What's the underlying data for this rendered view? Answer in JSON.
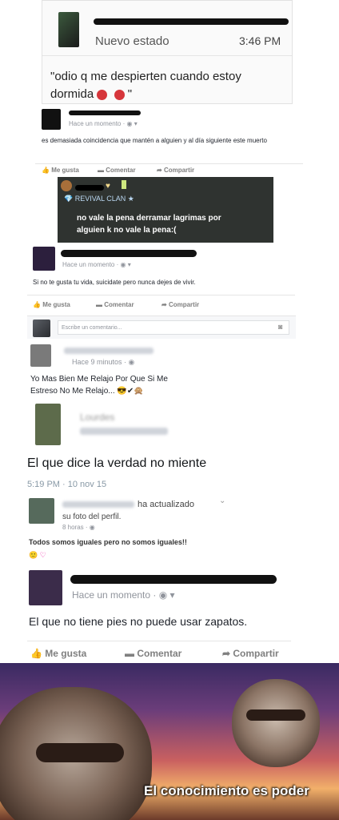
{
  "post1": {
    "status_label": "Nuevo estado",
    "time": "3:46 PM",
    "text_line1": "\"odio q me despierten cuando estoy",
    "text_line2_a": "dormida",
    "text_line2_b": "\""
  },
  "post2": {
    "time": "Hace un momento · ",
    "text": "es demasiada coincidencia que mantén a alguien y al día siguiente este muerto",
    "like": "Me gusta",
    "comment": "Comentar",
    "share": "Compartir"
  },
  "post3": {
    "clan": "REVIVAL CLAN ★",
    "text_line1": "no vale la pena derramar lagrimas por",
    "text_line2": "alguien k no vale la pena:("
  },
  "post4": {
    "time": "Hace un momento · ",
    "text": "Si no te gusta tu vida, suicidate pero nunca dejes de vivir.",
    "like": "Me gusta",
    "comment": "Comentar",
    "share": "Compartir",
    "comment_placeholder": "Escribe un comentario..."
  },
  "post5": {
    "time": "Hace 9 minutos · ",
    "text_line1": "Yo Mas Bien Me Relajo Por Que Si Me",
    "text_line2": "Estreso No Me Relajo..."
  },
  "post6": {
    "name": "Lourdes",
    "text": "El que dice la verdad no miente",
    "time": "5:19 PM · 10 nov 15"
  },
  "post7": {
    "action": "ha actualizado",
    "action2": "su foto del perfil.",
    "time": "8 horas · ",
    "text": "Todos somos iguales pero no somos iguales!!"
  },
  "post8": {
    "time": "Hace un momento · ",
    "text": "El que no tiene pies no puede usar zapatos.",
    "like": "Me gusta",
    "comment": "Comentar",
    "share": "Compartir"
  },
  "meme": {
    "caption": "El conocimiento es poder"
  }
}
